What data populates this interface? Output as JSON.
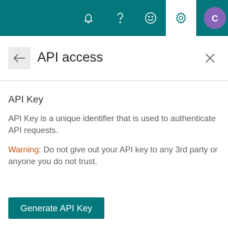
{
  "topbar": {
    "icons": [
      "bell-icon",
      "help-icon",
      "smile-icon",
      "gear-icon"
    ],
    "avatar_initial": "C",
    "accent": "#03787c",
    "avatar_color": "#8764b8"
  },
  "panel": {
    "title": "API access",
    "section_title": "API Key",
    "description": "API Key is a unique identifier that is used to authenticate API requests.",
    "warning_label": "Warning:",
    "warning_text": " Do not give out your API key to any 3rd party or anyone you do not trust.",
    "generate_button": "Generate API Key",
    "warning_color": "#ca5010"
  }
}
